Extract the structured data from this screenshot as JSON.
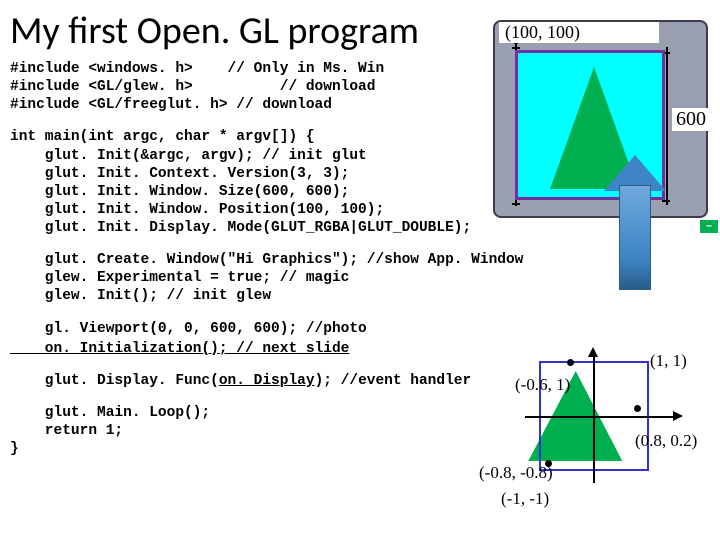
{
  "title": "My first Open. GL program",
  "code": {
    "includes": "#include <windows. h>    // Only in Ms. Win\n#include <GL/glew. h>          // download\n#include <GL/freeglut. h> // download",
    "main_open": "int main(int argc, char * argv[]) {\n    glut. Init(&argc, argv); // init glut\n    glut. Init. Context. Version(3, 3);\n    glut. Init. Window. Size(600, 600);\n    glut. Init. Window. Position(100, 100);\n    glut. Init. Display. Mode(GLUT_RGBA|GLUT_DOUBLE);",
    "create": "    glut. Create. Window(\"Hi Graphics\"); //show App. Window\n    glew. Experimental = true; // magic\n    glew. Init(); // init glew",
    "viewport1": "    gl. Viewport(0, 0, 600, 600); //photo",
    "viewport2": "    on. Initialization(); // next slide",
    "disp1": "    glut. Display. Func(",
    "disp2": "on. Display",
    "disp3": "); //event handler",
    "tail": "    glut. Main. Loop();\n    return 1;\n}"
  },
  "window": {
    "origin": "(100, 100)",
    "size": "600"
  },
  "plot": {
    "tr": "(1, 1)",
    "bl": "(-1, -1)",
    "p1": "(-0.6, 1)",
    "p2": "(-0.8, -0.8)",
    "p3": "(0.8, 0.2)"
  },
  "chart_data": {
    "type": "scatter",
    "title": "Normalized device coordinates with window placement",
    "window_position": [
      100,
      100
    ],
    "window_size": [
      600,
      600
    ],
    "ndc_range": {
      "x": [
        -1,
        1
      ],
      "y": [
        -1,
        1
      ]
    },
    "triangle_vertices": [
      {
        "x": -0.6,
        "y": 1.0
      },
      {
        "x": -0.8,
        "y": -0.8
      },
      {
        "x": 0.8,
        "y": 0.2
      }
    ],
    "labels": [
      "(-0.6, 1)",
      "(-0.8, -0.8)",
      "(0.8, 0.2)",
      "(1, 1)",
      "(-1, -1)"
    ]
  }
}
